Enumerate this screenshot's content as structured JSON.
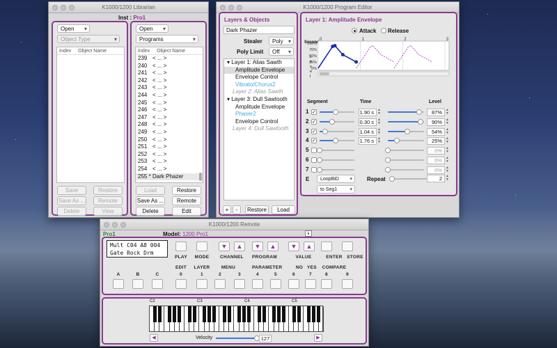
{
  "librarian": {
    "title": "K1000/1200 Librarian",
    "inst_label": "Inst :",
    "inst_value": "Pro1",
    "left": {
      "open": "Open",
      "object_type": "Object Type",
      "col_index": "Index",
      "col_name": "Object Name",
      "buttons": [
        "Save",
        "Restore",
        "Save As ...",
        "Remote",
        "Delete",
        "View"
      ]
    },
    "right": {
      "open": "Open",
      "type": "Programs",
      "col_index": "Index",
      "col_name": "Object Name",
      "rows": [
        [
          "239",
          "< ... >"
        ],
        [
          "240",
          "< ... >"
        ],
        [
          "241",
          "< ... >"
        ],
        [
          "242",
          "< ... >"
        ],
        [
          "243",
          "< ... >"
        ],
        [
          "244",
          "< ... >"
        ],
        [
          "245",
          "< ... >"
        ],
        [
          "246",
          "< ... >"
        ],
        [
          "247",
          "< ... >"
        ],
        [
          "248",
          "< ... >"
        ],
        [
          "249",
          "< ... >"
        ],
        [
          "250",
          "< ... >"
        ],
        [
          "251",
          "< ... >"
        ],
        [
          "252",
          "< ... >"
        ],
        [
          "253",
          "< ... >"
        ],
        [
          "254",
          "< ... >"
        ],
        [
          "255 *",
          "Dark Phazer"
        ]
      ],
      "buttons": [
        "Load",
        "Restore",
        "Save As ...",
        "Remote",
        "Delete",
        "Edit"
      ]
    }
  },
  "editor": {
    "title": "K1000/1200 Program Editor",
    "layers": {
      "title": "Layers & Objects",
      "name": "Dark Phazer",
      "stealer_label": "Stealer",
      "stealer": "Poly",
      "polylimit_label": "Poly Limit",
      "polylimit": "Off",
      "tree": [
        {
          "t": "▾ Layer 1: Alias Sawth",
          "k": "h"
        },
        {
          "t": "Amplitude Envelope",
          "k": "s"
        },
        {
          "t": "Envelope Control",
          "k": "n"
        },
        {
          "t": "Vibrato/Chorus2",
          "k": "b"
        },
        {
          "t": "Layer 2: Alias Sawth",
          "k": "g"
        },
        {
          "t": "▾ Layer 3: Dull Sawtooth",
          "k": "h"
        },
        {
          "t": "Amplitude Envelope",
          "k": "n"
        },
        {
          "t": "Phaser2",
          "k": "b"
        },
        {
          "t": "Envelope Control",
          "k": "n"
        },
        {
          "t": "Layer 4: Dull Sawtooth",
          "k": "g"
        }
      ],
      "add": "+",
      "remove": "-",
      "restore": "Restore",
      "load": "Load"
    },
    "env": {
      "title": "Layer 1: Amplitude Envelope",
      "attack": "Attack",
      "release": "Release",
      "seconds": "Seconds",
      "level": "Level",
      "xticks": [
        "0",
        "1",
        "2",
        "3"
      ],
      "yticks": [
        "100%",
        "75%",
        "50%",
        "25%",
        "0%"
      ],
      "seg_label": "Segment",
      "time_label": "Time",
      "level_label": "Level",
      "segments": [
        {
          "n": "1",
          "on": true,
          "time": "1.90 s",
          "level": "87%",
          "tf": 0.45,
          "lf": 0.87
        },
        {
          "n": "2",
          "on": true,
          "time": "0.30 s",
          "level": "90%",
          "tf": 0.35,
          "lf": 0.9
        },
        {
          "n": "3",
          "on": true,
          "time": "1.04 s",
          "level": "54%",
          "tf": 0.15,
          "lf": 0.54
        },
        {
          "n": "4",
          "on": true,
          "time": "1.76 s",
          "level": "25%",
          "tf": 0.45,
          "lf": 0.25
        },
        {
          "n": "5",
          "on": false,
          "time": "",
          "level": "0%",
          "tf": 0,
          "lf": 0
        },
        {
          "n": "6",
          "on": false,
          "time": "",
          "level": "0%",
          "tf": 0,
          "lf": 0
        },
        {
          "n": "7",
          "on": false,
          "time": "",
          "level": "0%",
          "tf": 0,
          "lf": 0
        }
      ],
      "e_label": "E",
      "loop": "LoopBiD",
      "to": "to Seg1",
      "repeat_label": "Repeat",
      "repeat": "2"
    }
  },
  "remote": {
    "title": "K1000/1200 Remote",
    "inst": "Pro1",
    "model_label": "Model:",
    "model": "1200 Pro1",
    "lcd1": "Mult C04 A8  004",
    "lcd2": "Gate Rock Drm",
    "top_labels": [
      "PLAY",
      "MODE",
      "CHANNEL",
      "PROGRAM",
      "VALUE",
      "ENTER",
      "STORE"
    ],
    "mid_labels": [
      "EDIT",
      "LAYER",
      "MENU",
      "PARAMETER",
      "NO",
      "YES",
      "COMPARE"
    ],
    "row_labels": [
      "A",
      "B",
      "C",
      "0",
      "1",
      "2",
      "3",
      "4",
      "5",
      "6",
      "7",
      "8",
      "9"
    ],
    "octaves": [
      "C2",
      "C3",
      "C4",
      "C5"
    ],
    "velocity_label": "Velocity",
    "velocity": "127",
    "velocity_frac": 0.98
  }
}
